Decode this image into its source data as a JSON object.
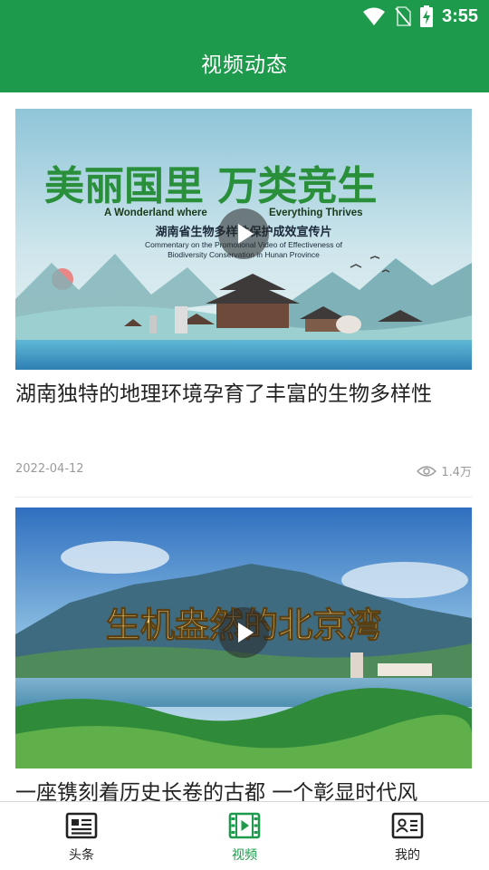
{
  "status_bar": {
    "time": "3:55",
    "icons": [
      "wifi-icon",
      "no-sim-icon",
      "battery-charging-icon"
    ]
  },
  "app_bar": {
    "title": "视频动态"
  },
  "colors": {
    "brand": "#1e9a4c",
    "meta_text": "#9a9a9a",
    "tab_active": "#1e9a4c"
  },
  "videos": [
    {
      "thumbnail": {
        "headline_cn": "美丽国里 万类竞生",
        "headline_en_left": "A Wonderland where",
        "headline_en_right": "Everything Thrives",
        "subtitle_cn": "湖南省生物多样性保护成效宣传片",
        "subtitle_en_1": "Commentary on the Promotional Video of Effectiveness of",
        "subtitle_en_2": "Biodiversity Conservation in Hunan Province"
      },
      "title": "湖南独特的地理环境孕育了丰富的生物多样性",
      "date": "2022-04-12",
      "views": "1.4万"
    },
    {
      "thumbnail": {
        "headline_cn": "生机盎然的北京湾"
      },
      "title": "一座镌刻着历史长卷的古都 一个彰显时代风",
      "date": "",
      "views": ""
    }
  ],
  "tab_bar": {
    "items": [
      {
        "label": "头条",
        "icon": "news-icon",
        "active": false
      },
      {
        "label": "视频",
        "icon": "video-film-icon",
        "active": true
      },
      {
        "label": "我的",
        "icon": "profile-card-icon",
        "active": false
      }
    ]
  }
}
